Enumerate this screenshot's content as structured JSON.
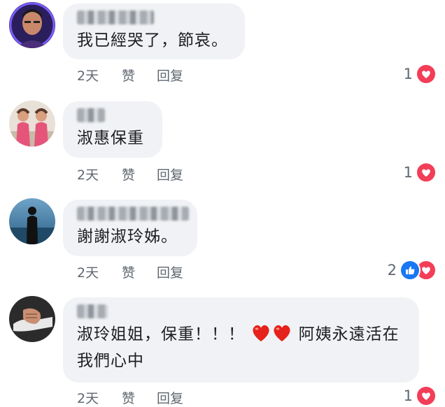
{
  "comments": [
    {
      "text_lines": [
        "我已經哭了，節哀。"
      ],
      "time": "2天",
      "like_label": "赞",
      "reply_label": "回复",
      "reaction_count": "1",
      "reactions": [
        "love-icon"
      ]
    },
    {
      "text_lines": [
        "淑惠保重"
      ],
      "time": "2天",
      "like_label": "赞",
      "reply_label": "回复",
      "reaction_count": "1",
      "reactions": [
        "love-icon"
      ]
    },
    {
      "text_lines": [
        "謝謝淑玲姊。"
      ],
      "time": "2天",
      "like_label": "赞",
      "reply_label": "回复",
      "reaction_count": "2",
      "reactions": [
        "like-icon",
        "love-icon"
      ]
    },
    {
      "text_line1_before": "淑玲姐姐，保重！！！",
      "text_line1_after": "阿姨永遠活在",
      "text_line2": "我們心中",
      "emojis": [
        "red-heart-emoji",
        "red-heart-emoji"
      ],
      "time": "2天",
      "like_label": "赞",
      "reply_label": "回复",
      "reaction_count": "1",
      "reactions": [
        "love-icon"
      ]
    }
  ],
  "colors": {
    "bubble": "#f0f2f5",
    "meta_text": "#606770",
    "love": "#f33e58",
    "like": "#1877f2"
  }
}
